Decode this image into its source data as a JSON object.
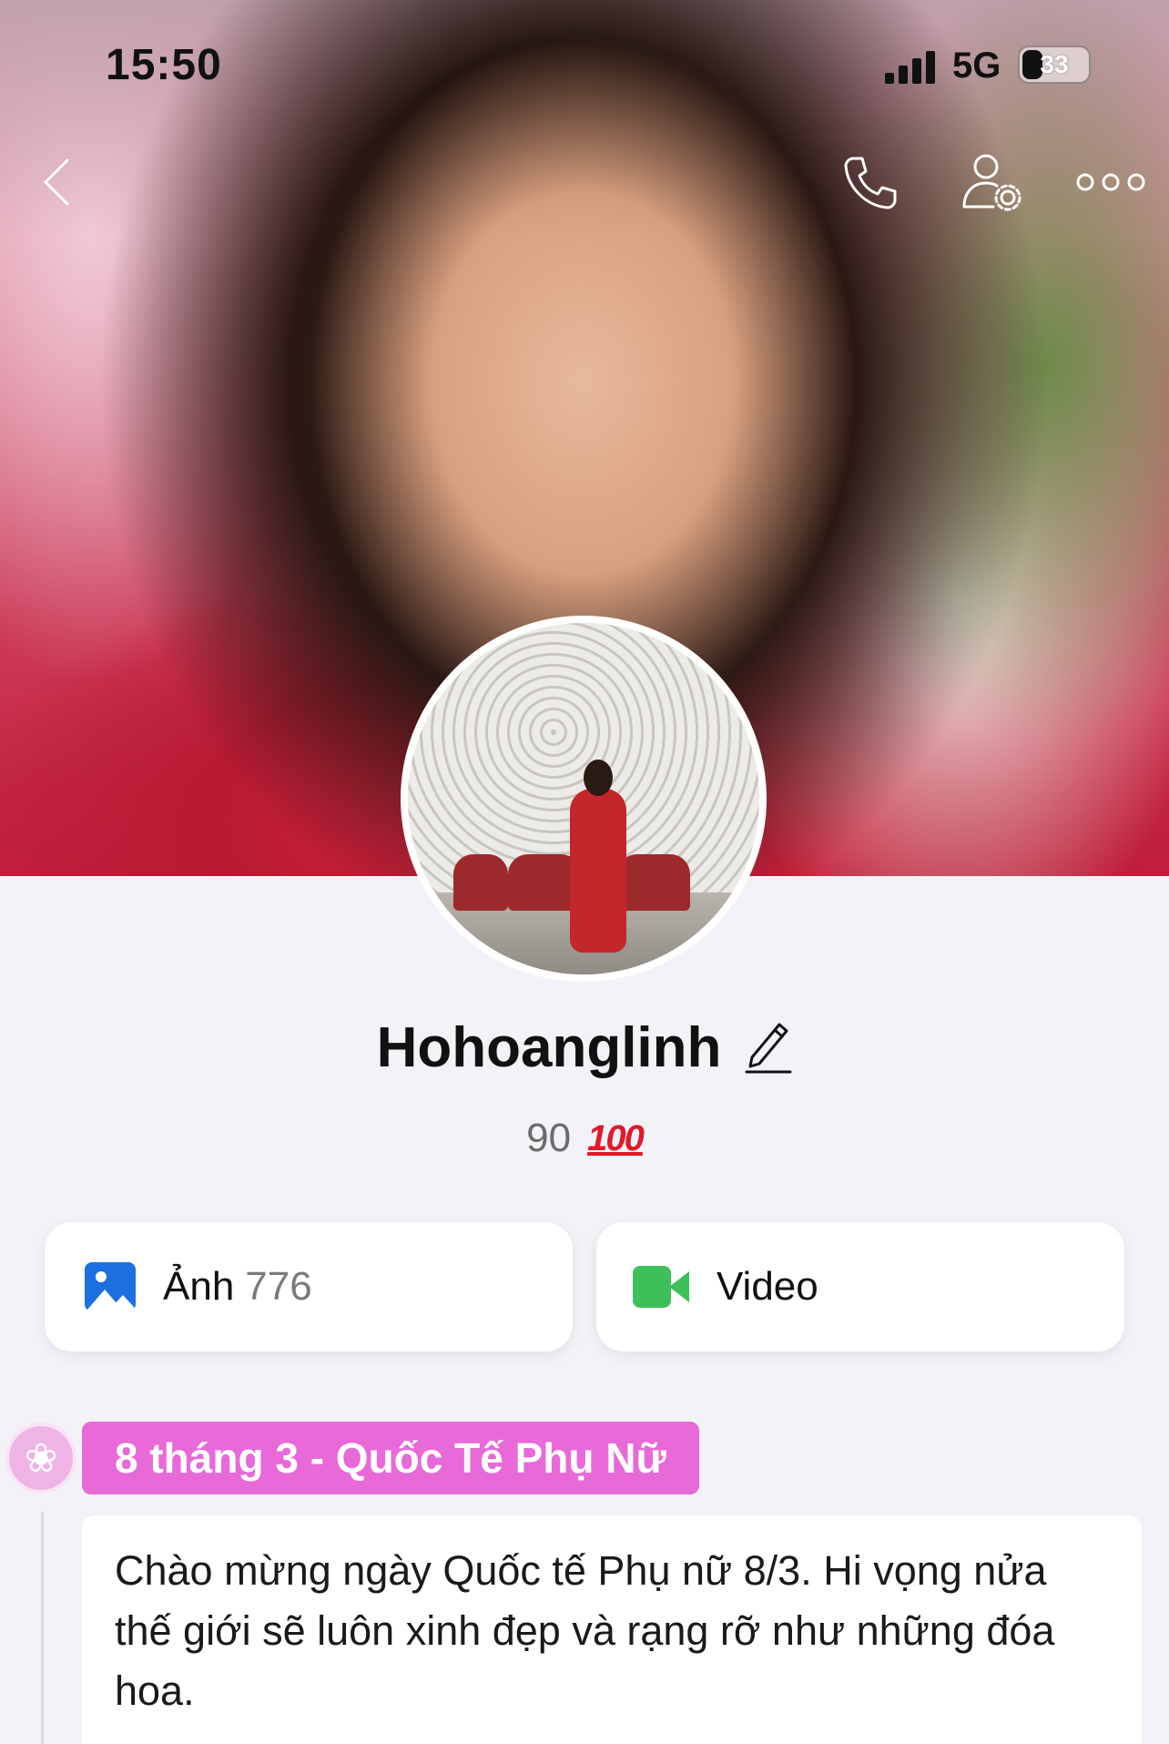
{
  "status_bar": {
    "time": "15:50",
    "network": "5G",
    "battery": "33"
  },
  "nav": {
    "back_icon": "chevron-left-icon",
    "call_icon": "phone-icon",
    "settings_icon": "user-settings-icon",
    "more_icon": "more-dots-icon"
  },
  "profile": {
    "name": "Hohoanglinh",
    "score": "90",
    "score_emoji": "100"
  },
  "media": {
    "photos_label": "Ảnh",
    "photos_count": "776",
    "video_label": "Video"
  },
  "timeline": {
    "event_icon": "rose-icon",
    "event_title": "8 tháng 3 - Quốc Tế Phụ Nữ",
    "post_text": "Chào mừng ngày Quốc tế Phụ nữ 8/3. Hi vọng nửa thế giới sẽ luôn xinh đẹp và rạng rỡ như những đóa hoa."
  },
  "colors": {
    "background": "#f2f2f7",
    "event_tag": "#e76ad8",
    "photo_icon": "#1c6fe0",
    "video_icon": "#3dbf5a"
  }
}
